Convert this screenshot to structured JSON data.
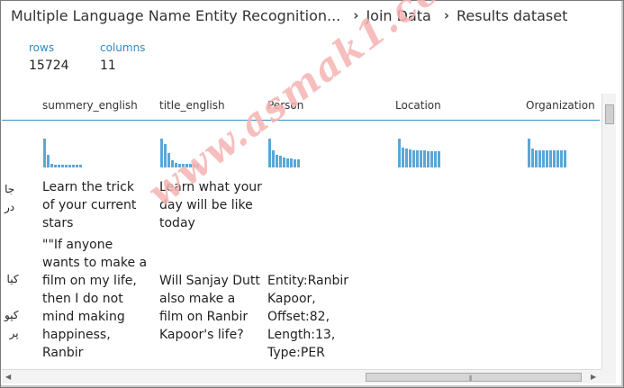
{
  "breadcrumb": {
    "items": [
      "Multiple Language Name Entity Recognition...",
      "Join Data",
      "Results dataset"
    ]
  },
  "stats": {
    "rows_label": "rows",
    "rows_value": "15724",
    "columns_label": "columns",
    "columns_value": "11"
  },
  "table": {
    "headers": [
      "summery_english",
      "title_english",
      "Person",
      "Location",
      "Organization"
    ],
    "histograms": {
      "summery_english": [
        1.0,
        0.45,
        0.12,
        0.1,
        0.1,
        0.1,
        0.1,
        0.1,
        0.1,
        0.1,
        0.1
      ],
      "title_english": [
        1.0,
        0.8,
        0.5,
        0.25,
        0.15,
        0.12,
        0.12,
        0.12,
        0.12,
        0.12,
        0.12
      ],
      "Person": [
        1.0,
        0.6,
        0.45,
        0.4,
        0.35,
        0.3,
        0.3,
        0.28,
        0.28
      ],
      "Location": [
        1.0,
        0.7,
        0.65,
        0.62,
        0.6,
        0.6,
        0.58,
        0.58,
        0.56,
        0.56,
        0.55,
        0.55
      ],
      "Organization": [
        1.0,
        0.65,
        0.6,
        0.6,
        0.6,
        0.6,
        0.6,
        0.6,
        0.6,
        0.6,
        0.6
      ]
    },
    "rows": [
      {
        "rtl_text": "جا\nدر",
        "summery_english": "Learn the trick of your current stars",
        "title_english": "Learn what your day will be like today",
        "person": ""
      },
      {
        "rtl_text": "کیا\n\nکپو\nپر",
        "summery_english": "\"\"If anyone wants to make a film on my life, then I do not mind making happiness, Ranbir",
        "title_english": "Will Sanjay Dutt also make a film on Ranbir Kapoor's life?",
        "person": "Entity:Ranbir Kapoor, Offset:82, Length:13, Type:PER"
      }
    ]
  },
  "watermark": "www.asmak1.com",
  "colors": {
    "accent": "#3a8fc6",
    "bar": "#5aa7d8"
  }
}
